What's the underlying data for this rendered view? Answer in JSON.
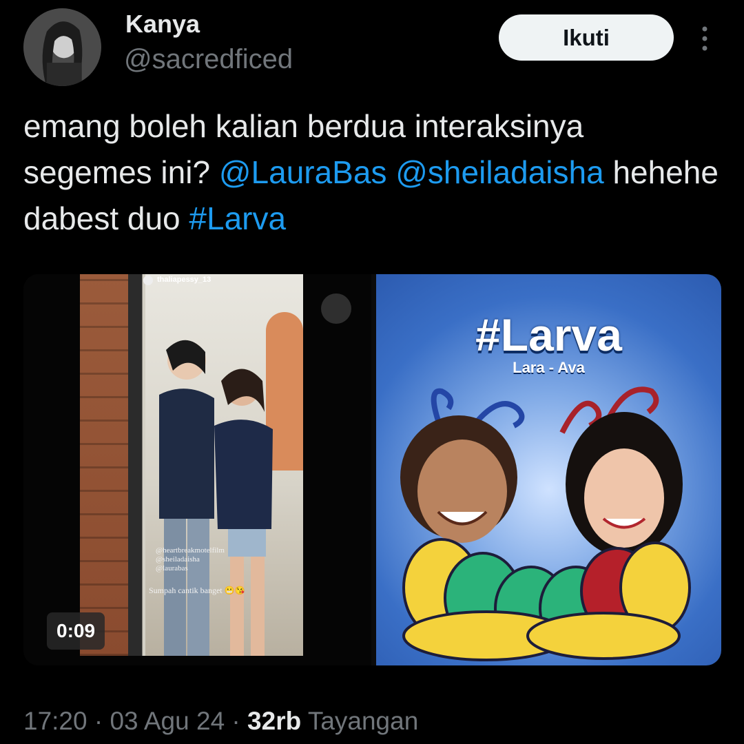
{
  "author": {
    "name": "Kanya",
    "handle": "@sacredficed"
  },
  "follow_label": "Ikuti",
  "tweet": {
    "text_1": "emang boleh kalian berdua interaksinya segemes ini? ",
    "mention_1": "@LauraBas",
    "space_1": " ",
    "mention_2": "@sheiladaisha",
    "text_2": " hehehe dabest duo ",
    "hashtag": "#Larva"
  },
  "media": {
    "video": {
      "duration": "0:09",
      "overlay_user": "thaliapessy_13",
      "overlay_tags": [
        "@heartbreakmotelfilm",
        "@sheiladaisha",
        "@laurabas"
      ],
      "overlay_caption": "Sumpah cantik banget 😬😘"
    },
    "poster": {
      "title": "#Larva",
      "subtitle": "Lara - Ava"
    }
  },
  "meta": {
    "time": "17:20",
    "sep_1": " · ",
    "date": "03 Agu 24",
    "sep_2": " · ",
    "views_count": "32rb",
    "views_label": " Tayangan"
  },
  "colors": {
    "background": "#000000",
    "link": "#1d9bf0",
    "muted": "#71767b"
  }
}
